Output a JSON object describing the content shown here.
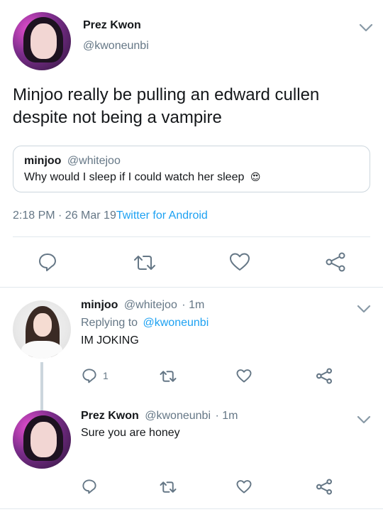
{
  "main_tweet": {
    "author_name": "Prez Kwon",
    "author_handle": "@kwoneunbi",
    "text_line1": "Minjoo really be pulling an edward cullen",
    "text_line2": "despite not being a vampire",
    "quote": {
      "author_name": "minjoo",
      "author_handle": "@whitejoo",
      "text": "Why would I sleep if I could watch her sleep",
      "emoji": "😍"
    },
    "time": "2:18 PM · 26 Mar 19",
    "source": "Twitter for Android"
  },
  "reply1": {
    "author_name": "minjoo",
    "author_handle": "@whitejoo",
    "age": "· 1m",
    "replying_prefix": "Replying to",
    "replying_to": "@kwoneunbi",
    "text": "IM JOKING",
    "reply_count": "1"
  },
  "reply2": {
    "author_name": "Prez Kwon",
    "author_handle": "@kwoneunbi",
    "age": "· 1m",
    "text": "Sure you are honey"
  },
  "icons": {
    "reply": "reply-icon",
    "retweet": "retweet-icon",
    "like": "heart-icon",
    "share": "share-icon",
    "menu": "chevron-down-icon"
  },
  "colors": {
    "accent": "#1da1f2",
    "muted": "#657786",
    "divider": "#e1e8ed"
  }
}
